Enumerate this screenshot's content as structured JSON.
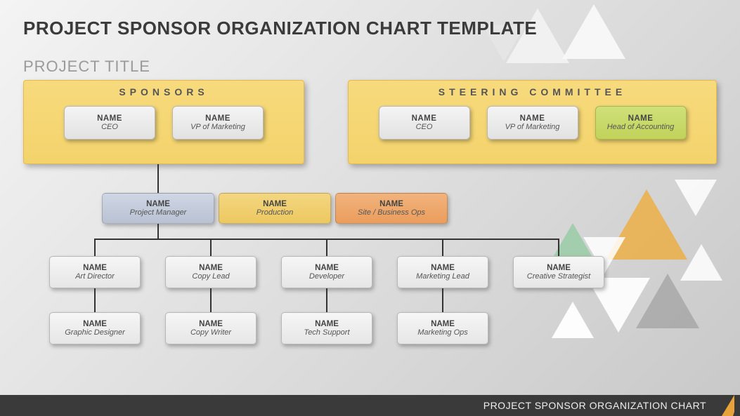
{
  "title": "PROJECT SPONSOR ORGANIZATION CHART TEMPLATE",
  "subtitle": "PROJECT TITLE",
  "panels": {
    "sponsors": {
      "title": "SPONSORS",
      "members": [
        {
          "name": "NAME",
          "role": "CEO"
        },
        {
          "name": "NAME",
          "role": "VP of Marketing"
        }
      ]
    },
    "steering": {
      "title": "STEERING COMMITTEE",
      "members": [
        {
          "name": "NAME",
          "role": "CEO"
        },
        {
          "name": "NAME",
          "role": "VP of Marketing"
        },
        {
          "name": "NAME",
          "role": "Head of Accounting"
        }
      ]
    }
  },
  "managers": [
    {
      "name": "NAME",
      "role": "Project Manager"
    },
    {
      "name": "NAME",
      "role": "Production"
    },
    {
      "name": "NAME",
      "role": "Site / Business Ops"
    }
  ],
  "row1": [
    {
      "name": "NAME",
      "role": "Art Director"
    },
    {
      "name": "NAME",
      "role": "Copy Lead"
    },
    {
      "name": "NAME",
      "role": "Developer"
    },
    {
      "name": "NAME",
      "role": "Marketing Lead"
    },
    {
      "name": "NAME",
      "role": "Creative Strategist"
    }
  ],
  "row2": [
    {
      "name": "NAME",
      "role": "Graphic Designer"
    },
    {
      "name": "NAME",
      "role": "Copy Writer"
    },
    {
      "name": "NAME",
      "role": "Tech Support"
    },
    {
      "name": "NAME",
      "role": "Marketing Ops"
    }
  ],
  "footer": "PROJECT SPONSOR ORGANIZATION CHART",
  "chart_data": {
    "type": "org-chart",
    "groups": [
      {
        "label": "SPONSORS",
        "members": [
          {
            "name": "NAME",
            "role": "CEO"
          },
          {
            "name": "NAME",
            "role": "VP of Marketing"
          }
        ]
      },
      {
        "label": "STEERING COMMITTEE",
        "members": [
          {
            "name": "NAME",
            "role": "CEO"
          },
          {
            "name": "NAME",
            "role": "VP of Marketing"
          },
          {
            "name": "NAME",
            "role": "Head of Accounting"
          }
        ]
      }
    ],
    "hierarchy": {
      "name": "NAME",
      "role": "Project Manager",
      "peers": [
        {
          "name": "NAME",
          "role": "Production"
        },
        {
          "name": "NAME",
          "role": "Site / Business Ops"
        }
      ],
      "children": [
        {
          "name": "NAME",
          "role": "Art Director",
          "children": [
            {
              "name": "NAME",
              "role": "Graphic Designer"
            }
          ]
        },
        {
          "name": "NAME",
          "role": "Copy Lead",
          "children": [
            {
              "name": "NAME",
              "role": "Copy Writer"
            }
          ]
        },
        {
          "name": "NAME",
          "role": "Developer",
          "children": [
            {
              "name": "NAME",
              "role": "Tech Support"
            }
          ]
        },
        {
          "name": "NAME",
          "role": "Marketing Lead",
          "children": [
            {
              "name": "NAME",
              "role": "Marketing Ops"
            }
          ]
        },
        {
          "name": "NAME",
          "role": "Creative Strategist"
        }
      ]
    }
  }
}
